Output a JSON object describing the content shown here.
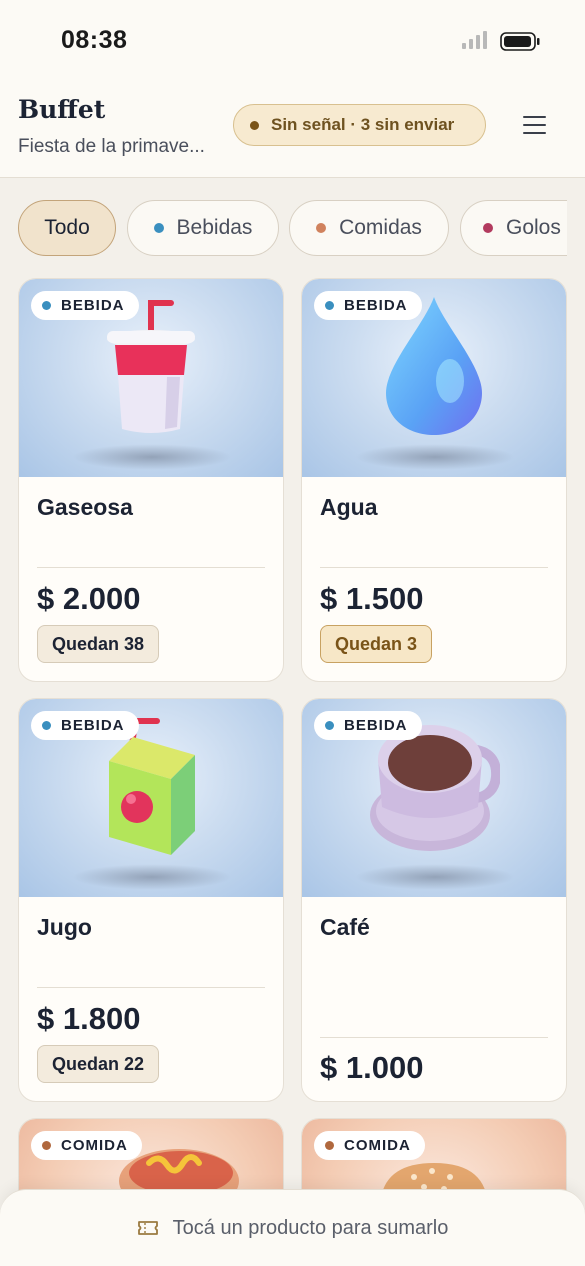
{
  "status_bar": {
    "time": "08:38"
  },
  "header": {
    "title": "Buffet",
    "subtitle": "Fiesta de la primave...",
    "sync_badge": "Sin señal · 3 sin enviar",
    "menu_icon": "hamburger-menu-icon"
  },
  "filters": [
    {
      "label": "Todo",
      "active": true
    },
    {
      "label": "Bebidas",
      "dot_color": "#3a8fbf"
    },
    {
      "label": "Comidas",
      "dot_color": "#d0825d"
    },
    {
      "label": "Golos",
      "dot_color": "#b23a5e"
    }
  ],
  "colors": {
    "bebida": "#3a8fbf",
    "comida": "#b0683e",
    "accent": "#7a5418"
  },
  "products": [
    {
      "category": "BEBIDA",
      "name": "Gaseosa",
      "price": "$ 2.000",
      "stock": "Quedan 38",
      "low_stock": false,
      "icon": "soda-cup-icon"
    },
    {
      "category": "BEBIDA",
      "name": "Agua",
      "price": "$ 1.500",
      "stock": "Quedan 3",
      "low_stock": true,
      "icon": "water-drop-icon"
    },
    {
      "category": "BEBIDA",
      "name": "Jugo",
      "price": "$ 1.800",
      "stock": "Quedan 22",
      "low_stock": false,
      "icon": "juice-box-icon"
    },
    {
      "category": "BEBIDA",
      "name": "Café",
      "price": "$ 1.000",
      "icon": "coffee-cup-icon"
    },
    {
      "category": "COMIDA",
      "icon": "hot-dog-icon"
    },
    {
      "category": "COMIDA",
      "icon": "hamburger-icon"
    }
  ],
  "bottom_bar": {
    "hint": "Tocá un producto para sumarlo",
    "icon": "ticket-icon"
  }
}
